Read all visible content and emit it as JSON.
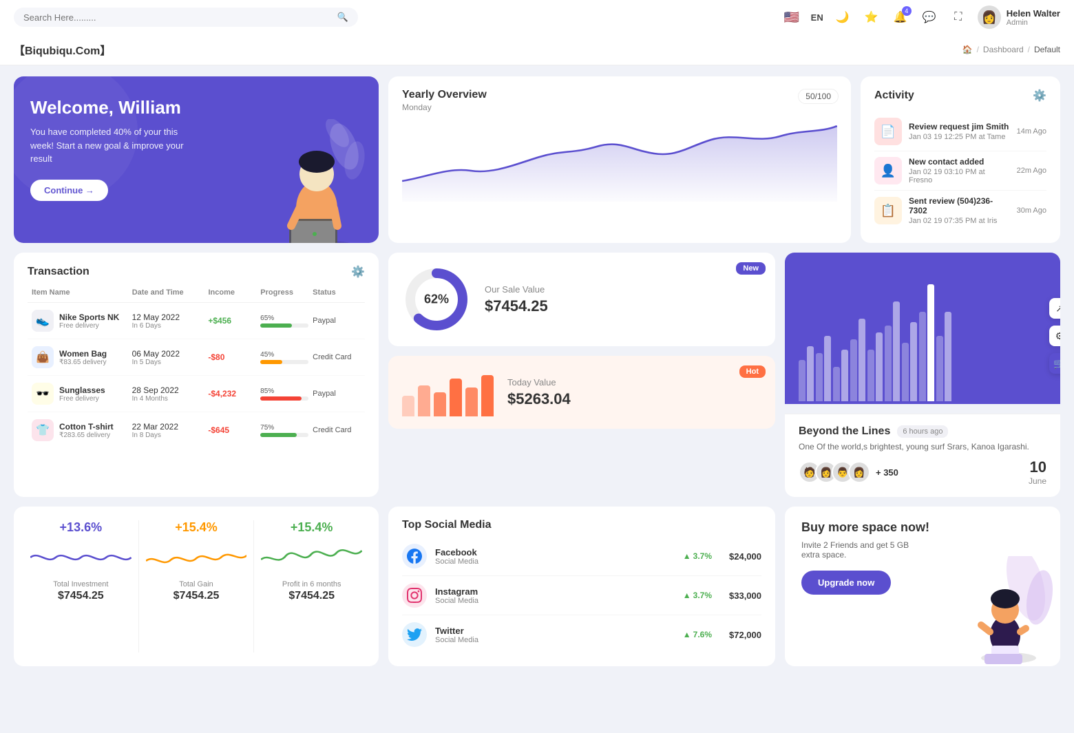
{
  "topbar": {
    "search_placeholder": "Search Here.........",
    "lang": "EN",
    "user": {
      "name": "Helen Walter",
      "role": "Admin",
      "avatar_emoji": "👤"
    },
    "notification_count": "4"
  },
  "breadcrumb": {
    "brand": "【Biqubiqu.Com】",
    "home": "🏠",
    "separator": "/",
    "dashboard": "Dashboard",
    "current": "Default"
  },
  "welcome": {
    "title": "Welcome, William",
    "subtitle": "You have completed 40% of your this week! Start a new goal & improve your result",
    "button": "Continue →"
  },
  "yearly_overview": {
    "title": "Yearly Overview",
    "subtitle": "Monday",
    "badge": "50/100"
  },
  "activity": {
    "title": "Activity",
    "items": [
      {
        "title": "Review request jim Smith",
        "subtitle": "Jan 03 19 12:25 PM at Tame",
        "time": "14m Ago",
        "emoji": "📄"
      },
      {
        "title": "New contact added",
        "subtitle": "Jan 02 19 03:10 PM at Fresno",
        "time": "22m Ago",
        "emoji": "👤"
      },
      {
        "title": "Sent review (504)236-7302",
        "subtitle": "Jan 02 19 07:35 PM at Iris",
        "time": "30m Ago",
        "emoji": "📋"
      }
    ]
  },
  "transaction": {
    "title": "Transaction",
    "headers": [
      "Item Name",
      "Date and Time",
      "Income",
      "Progress",
      "Status"
    ],
    "rows": [
      {
        "name": "Nike Sports NK",
        "sub": "Free delivery",
        "date": "12 May 2022",
        "days": "In 6 Days",
        "income": "+$456",
        "income_type": "pos",
        "progress": 65,
        "progress_color": "#4caf50",
        "status": "Paypal",
        "emoji": "👟"
      },
      {
        "name": "Women Bag",
        "sub": "₹83.65 delivery",
        "date": "06 May 2022",
        "days": "In 5 Days",
        "income": "-$80",
        "income_type": "neg",
        "progress": 45,
        "progress_color": "#ff9800",
        "status": "Credit Card",
        "emoji": "👜"
      },
      {
        "name": "Sunglasses",
        "sub": "Free delivery",
        "date": "28 Sep 2022",
        "days": "In 4 Months",
        "income": "-$4,232",
        "income_type": "neg",
        "progress": 85,
        "progress_color": "#f44336",
        "status": "Paypal",
        "emoji": "🕶️"
      },
      {
        "name": "Cotton T-shirt",
        "sub": "₹283.65 delivery",
        "date": "22 Mar 2022",
        "days": "In 8 Days",
        "income": "-$645",
        "income_type": "neg",
        "progress": 75,
        "progress_color": "#4caf50",
        "status": "Credit Card",
        "emoji": "👕"
      }
    ]
  },
  "sale_value": {
    "title": "Our Sale Value",
    "value": "$7454.25",
    "percent": 62,
    "badge": "New",
    "today_title": "Today Value",
    "today_value": "$5263.04",
    "today_badge": "Hot"
  },
  "beyond": {
    "title": "Beyond the Lines",
    "time_ago": "6 hours ago",
    "desc": "One Of the world,s brightest, young surf Srars, Kanoa Igarashi.",
    "avatars": [
      "🧑",
      "👩",
      "👨",
      "👩"
    ],
    "plus_count": "+ 350",
    "date_num": "10",
    "date_month": "June"
  },
  "mini_stats": [
    {
      "percent": "+13.6%",
      "label": "Total Investment",
      "value": "$7454.25",
      "color": "#5b4fcf"
    },
    {
      "percent": "+15.4%",
      "label": "Total Gain",
      "value": "$7454.25",
      "color": "#ff9800"
    },
    {
      "percent": "+15.4%",
      "label": "Profit in 6 months",
      "value": "$7454.25",
      "color": "#4caf50"
    }
  ],
  "social_media": {
    "title": "Top Social Media",
    "items": [
      {
        "name": "Facebook",
        "type": "Social Media",
        "growth": "3.7%",
        "revenue": "$24,000",
        "color": "#1877f2",
        "emoji": "f"
      },
      {
        "name": "Instagram",
        "type": "Social Media",
        "growth": "3.7%",
        "revenue": "$33,000",
        "color": "#e1306c",
        "emoji": "📷"
      },
      {
        "name": "Twitter",
        "type": "Social Media",
        "growth": "7.6%",
        "revenue": "$72,000",
        "color": "#1da1f2",
        "emoji": "🐦"
      }
    ]
  },
  "buy_space": {
    "title": "Buy more space now!",
    "desc": "Invite 2 Friends and get 5 GB extra space.",
    "button": "Upgrade now"
  }
}
